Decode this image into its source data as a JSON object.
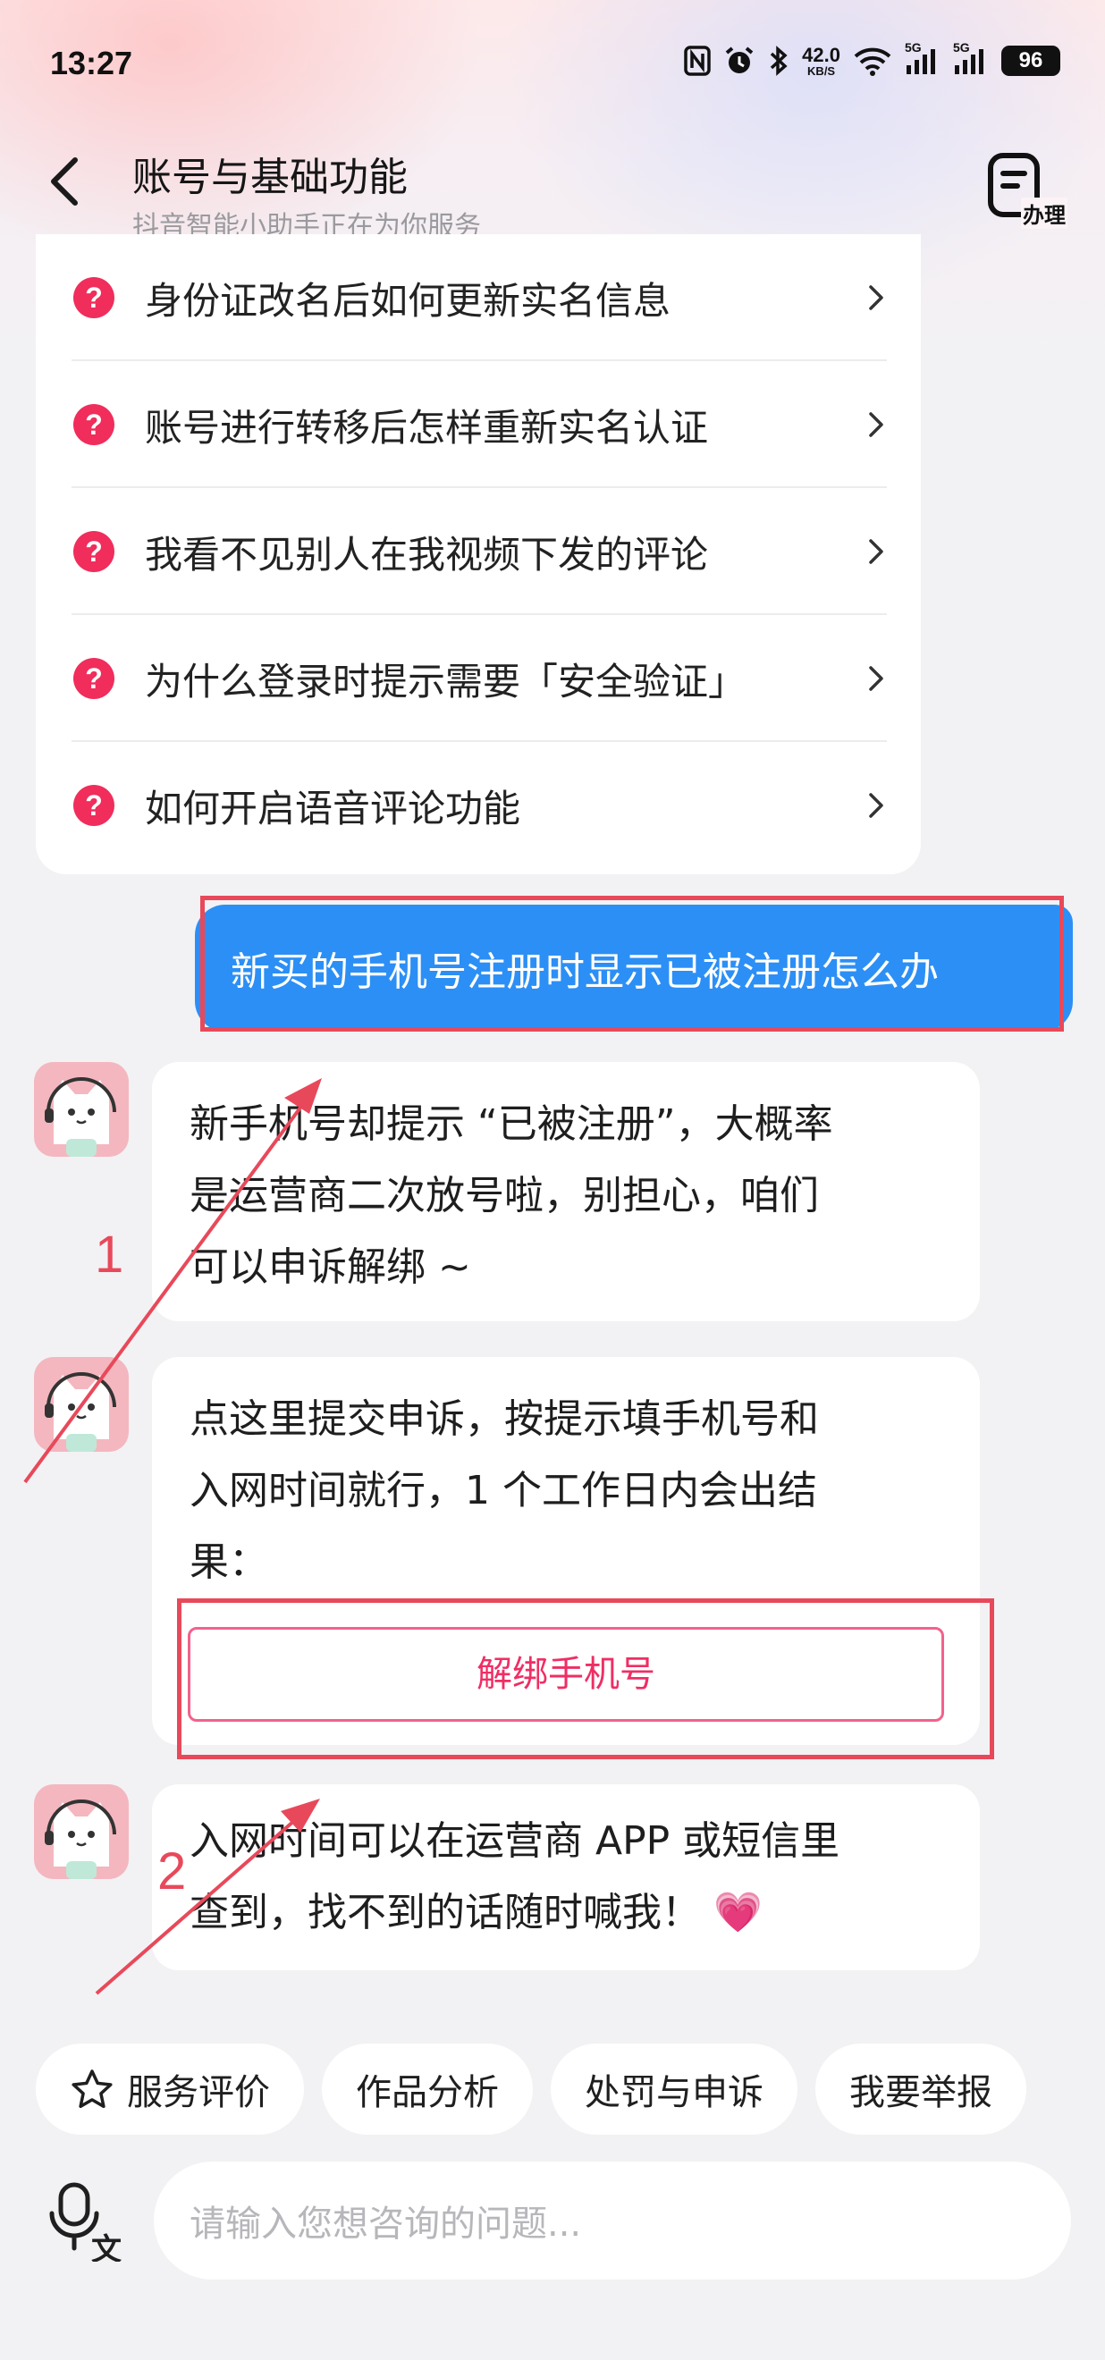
{
  "status_bar": {
    "time": "13:27",
    "net_speed_value": "42.0",
    "net_speed_unit": "KB/S",
    "sim1": "5G",
    "sim2": "5G",
    "battery": "96",
    "icons": [
      "nfc-icon",
      "alarm-icon",
      "bluetooth-icon",
      "wifi-icon",
      "signal-icon",
      "signal-icon",
      "battery-icon"
    ]
  },
  "header": {
    "title": "账号与基础功能",
    "subtitle": "抖音智能小助手正在为你服务",
    "action_label": "办理"
  },
  "faq": {
    "items": [
      {
        "label": "身份证改名后如何更新实名信息"
      },
      {
        "label": "账号进行转移后怎样重新实名认证"
      },
      {
        "label": "我看不见别人在我视频下发的评论"
      },
      {
        "label": "为什么登录时提示需要「安全验证」"
      },
      {
        "label": "如何开启语音评论功能"
      }
    ]
  },
  "conversation": {
    "user_message": "新买的手机号注册时显示已被注册怎么办",
    "bot_messages": [
      {
        "lines": [
          "新手机号却提示 “已被注册”，大概率",
          "是运营商二次放号啦，别担心，咱们",
          "可以申诉解绑 ~"
        ]
      },
      {
        "lines": [
          "点这里提交申诉，按提示填手机号和",
          "入网时间就行，1 个工作日内会出结",
          "果："
        ],
        "button_label": "解绑手机号"
      },
      {
        "lines": [
          "入网时间可以在运营商 APP 或短信里",
          "查到，找不到的话随时喊我！ 💗"
        ]
      }
    ]
  },
  "annotations": {
    "label_1": "1",
    "label_2": "2",
    "color": "#e8495a"
  },
  "quick_actions": [
    {
      "label": "服务评价",
      "icon": "star-icon"
    },
    {
      "label": "作品分析"
    },
    {
      "label": "处罚与申诉"
    },
    {
      "label": "我要举报"
    }
  ],
  "input": {
    "placeholder": "请输入您想咨询的问题..."
  },
  "colors": {
    "accent_pink": "#f02d5b",
    "user_bubble": "#2c8ff5",
    "background": "#f2f2f4"
  }
}
